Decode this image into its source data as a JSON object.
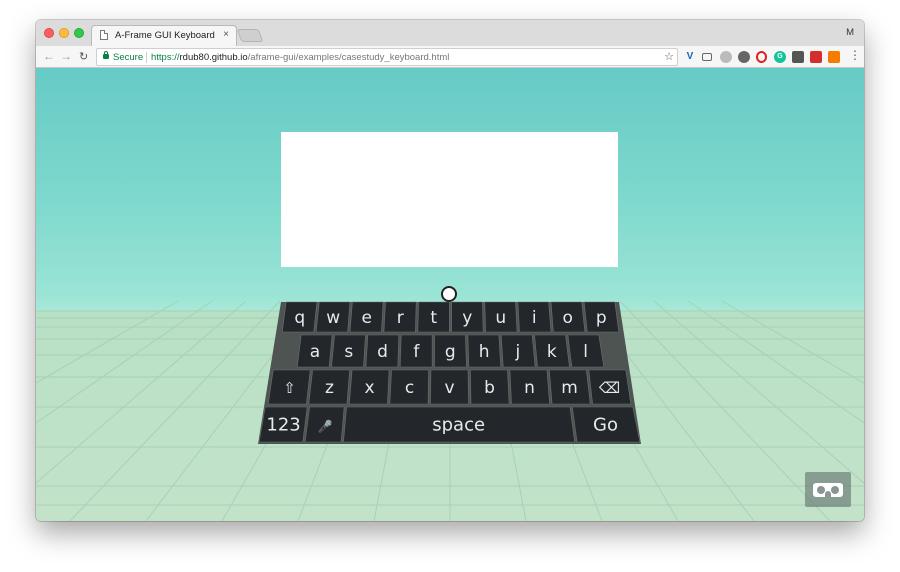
{
  "browser": {
    "tab_title": "A-Frame GUI Keyboard",
    "tab_close": "×",
    "profile_initial": "M",
    "secure_label": "Secure",
    "url_scheme": "https://",
    "url_host": "rdub80.github.io",
    "url_path": "/aframe-gui/examples/casestudy_keyboard.html",
    "extensions": [
      "vimium-icon",
      "cast-icon",
      "extension-icon",
      "settings-extension-icon",
      "opera-icon",
      "grammarly-icon",
      "extension-icon",
      "extension-icon",
      "extension-icon"
    ],
    "colors": {
      "secure": "#0b8043",
      "scene_top": "#66cbc6",
      "floor": "#c3e3c9",
      "key": "#23272b"
    }
  },
  "keyboard": {
    "row1": [
      "q",
      "w",
      "e",
      "r",
      "t",
      "y",
      "u",
      "i",
      "o",
      "p"
    ],
    "row2": [
      "a",
      "s",
      "d",
      "f",
      "g",
      "h",
      "j",
      "k",
      "l"
    ],
    "row3": [
      "⇧",
      "z",
      "x",
      "c",
      "v",
      "b",
      "n",
      "m",
      "⌫"
    ],
    "row4": [
      "123",
      "🎤",
      "space",
      "Go"
    ]
  }
}
